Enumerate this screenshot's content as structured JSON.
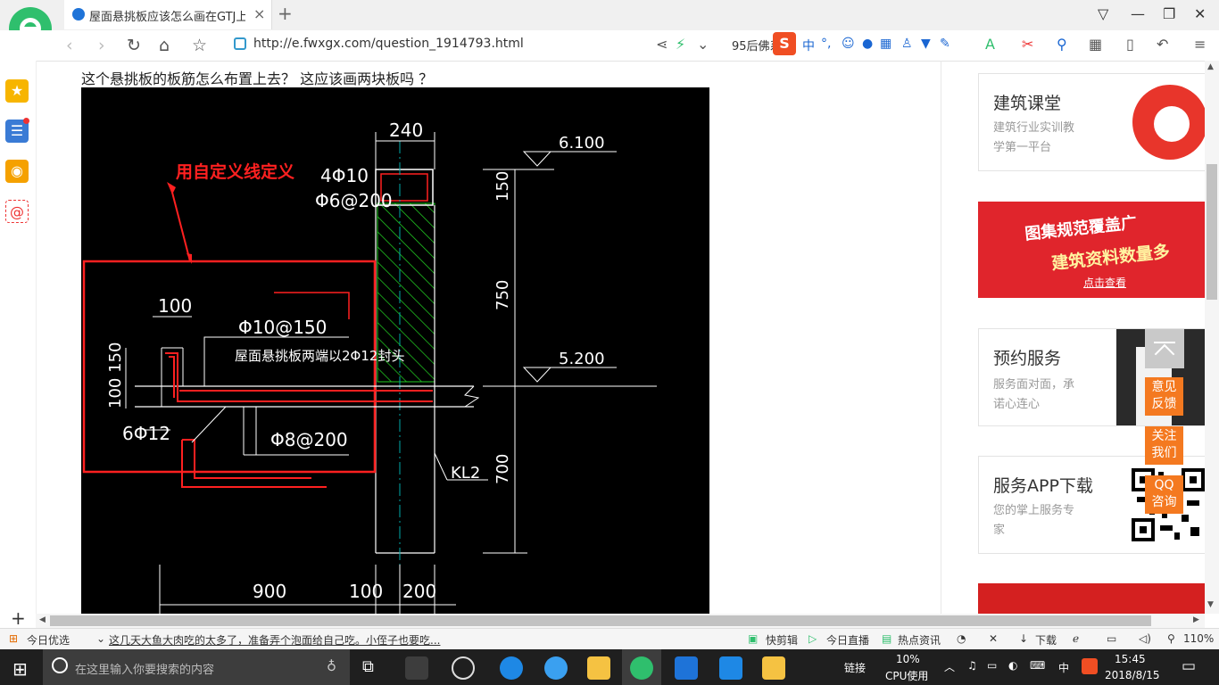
{
  "browser": {
    "tab_title": "屋面悬挑板应该怎么画在GTJ上？",
    "tab_close": "×",
    "new_tab": "+",
    "url": "http://e.fwxgx.com/question_1914793.html",
    "url_extra": "95后佛系",
    "sogou": "S",
    "ime_label": "中"
  },
  "page": {
    "question_text": "这个悬挑板的板筋怎么布置上去？ 这应该画两块板吗 ？"
  },
  "drawing": {
    "note_custom_line": "用自定义线定义",
    "dim_240": "240",
    "rebar_4phi10": "4Φ10",
    "rebar_phi6": "Φ6@200",
    "elev_6100": "6.100",
    "dim_150": "150",
    "dim_750": "750",
    "elev_5200": "5.200",
    "dim_100_top": "100",
    "rebar_phi10_150": "Φ10@150",
    "note_slab_end": "屋面悬挑板两端以2Φ12封头",
    "dim_100_150": "100 150",
    "rebar_6phi12": "6Φ12",
    "rebar_phi8": "Φ8@200",
    "beam_kl2": "KL2",
    "dim_700": "700",
    "dim_900": "900",
    "dim_100_bottom": "100",
    "dim_200": "200"
  },
  "sidebar_right": {
    "card1_title": "建筑课堂",
    "card1_sub1": "建筑行业实训教",
    "card1_sub2": "学第一平台",
    "banner_line1": "图集规范覆盖广",
    "banner_line2": "建筑资料数量多",
    "banner_link": "点击查看",
    "card2_title": "预约服务",
    "card2_sub1": "服务面对面，承",
    "card2_sub2": "诺心连心",
    "card3_title": "服务APP下载",
    "card3_sub1": "您的掌上服务专",
    "card3_sub2": "家"
  },
  "float_buttons": {
    "feedback_1": "意见",
    "feedback_2": "反馈",
    "follow_1": "关注",
    "follow_2": "我们",
    "qq_1": "QQ",
    "qq_2": "咨询"
  },
  "statusbar": {
    "today_pick": "今日优选",
    "news": "这几天大鱼大肉吃的太多了，准备弄个泡面给自己吃。小侄子也要吃...",
    "clip": "快剪辑",
    "live": "今日直播",
    "hot": "热点资讯",
    "download": "下载",
    "zoom": "110%"
  },
  "taskbar": {
    "search_placeholder": "在这里输入你要搜索的内容",
    "link": "链接",
    "cpu_percent": "10%",
    "cpu_label": "CPU使用",
    "ime": "中",
    "time": "15:45",
    "date": "2018/8/15"
  },
  "colors": {
    "accent_green": "#2fbf6d",
    "cad_red": "#ff2020",
    "cad_green": "#22cc22",
    "float_orange": "#f47920"
  }
}
